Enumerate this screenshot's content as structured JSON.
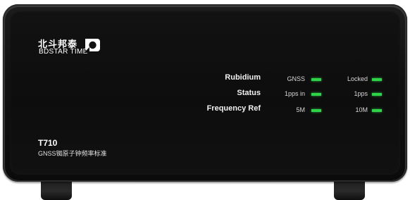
{
  "brand": {
    "name_cn": "北斗邦泰",
    "name_en": "BDSTAR TIME",
    "logo_icon": "bdstar-logo-icon"
  },
  "status_rows": [
    {
      "label": "Rubidium",
      "ind1": "GNSS",
      "ind2": "Locked"
    },
    {
      "label": "Status",
      "ind1": "1pps in",
      "ind2": "1pps"
    },
    {
      "label": "Frequency Ref",
      "ind1": "5M",
      "ind2": "10M"
    }
  ],
  "led_color": "#2fd34a",
  "model": {
    "name": "T710",
    "description": "GNSS铷原子钟频率标准"
  }
}
